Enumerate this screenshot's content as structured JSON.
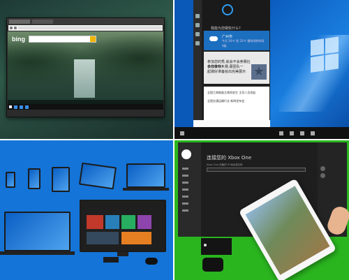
{
  "bing": {
    "logo": "bing"
  },
  "cortana": {
    "greeting": "我能为您做些什么?",
    "weather": {
      "city": "广州市",
      "detail": "今天 26℃ 到 32℃ 雷阵雨转阵雨",
      "extra": "4级"
    },
    "card": {
      "title": "参加您的秀,就会不会参赛社会你争夺?",
      "body": "参加模特大赛,跟团队一起做好准备给出完美展示"
    },
    "news": [
      "全国工商联副主席再发生 主导人员发起",
      "全国交通运输行业 新闻发布会"
    ]
  },
  "xbox": {
    "title": "连接您的 Xbox One",
    "subtitle": "Xbox One 设备的 IP 地址或名称"
  },
  "colors": {
    "q2_bg": "#0a58b8",
    "q3_bg": "#1474d8",
    "q4_bg": "#2ab51f",
    "accent": "#2e9cf0"
  }
}
